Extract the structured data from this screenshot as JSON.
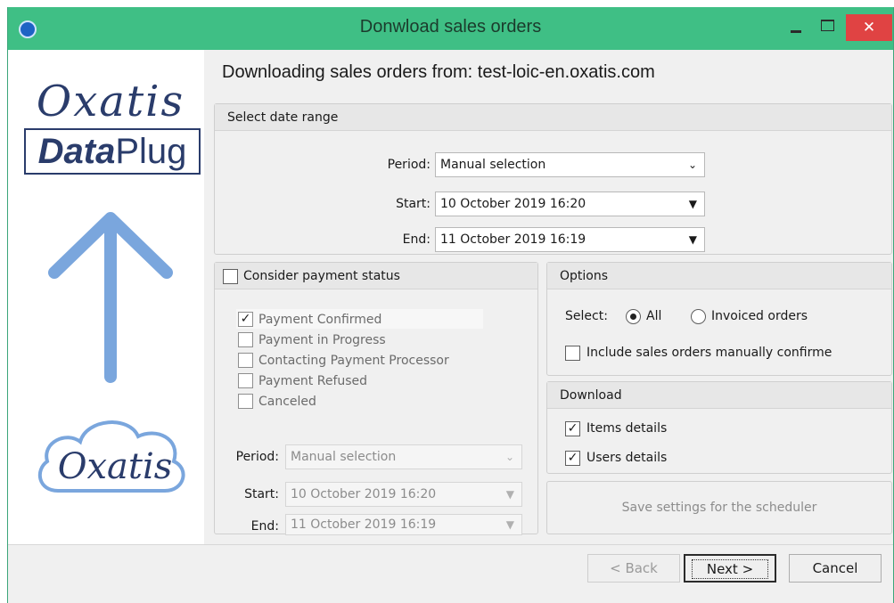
{
  "window": {
    "title": "Donwload sales orders",
    "close_glyph": "✕"
  },
  "brand": {
    "logo_text": "Oxatis",
    "product_bold": "Data",
    "product_rest": "Plug",
    "cloud_text": "Oxatis"
  },
  "heading": "Downloading sales orders from: test-loic-en.oxatis.com",
  "date_range": {
    "title": "Select date range",
    "period_label": "Period:",
    "period_value": "Manual selection",
    "start_label": "Start:",
    "start_value": "10 October 2019 16:20",
    "end_label": "End:",
    "end_value": "11 October 2019 16:19"
  },
  "payment": {
    "title": "Consider payment status",
    "checked": false,
    "statuses": [
      {
        "label": "Payment Confirmed",
        "checked": true
      },
      {
        "label": "Payment in Progress",
        "checked": false
      },
      {
        "label": "Contacting Payment Processor",
        "checked": false
      },
      {
        "label": "Payment Refused",
        "checked": false
      },
      {
        "label": "Canceled",
        "checked": false
      }
    ],
    "period_label": "Period:",
    "period_value": "Manual selection",
    "start_label": "Start:",
    "start_value": "10 October 2019 16:20",
    "end_label": "End:",
    "end_value": "11 October 2019 16:19"
  },
  "options": {
    "title": "Options",
    "select_label": "Select:",
    "radio_all": "All",
    "radio_invoiced": "Invoiced orders",
    "selected": "All",
    "include_manual_label": "Include sales orders manually confirme",
    "include_manual_checked": false
  },
  "download": {
    "title": "Download",
    "items_label": "Items details",
    "items_checked": true,
    "users_label": "Users details",
    "users_checked": true
  },
  "save_settings_label": "Save settings for the scheduler",
  "buttons": {
    "back": "< Back",
    "next": "Next >",
    "cancel": "Cancel"
  },
  "colors": {
    "titlebar": "#3fbf85",
    "close": "#e04343",
    "brand_navy": "#2a3c6b",
    "arrow": "#7aa6dd"
  },
  "icons": {
    "app": "app-icon",
    "dropdown": "chevron-down-icon",
    "check": "checkmark-icon"
  }
}
